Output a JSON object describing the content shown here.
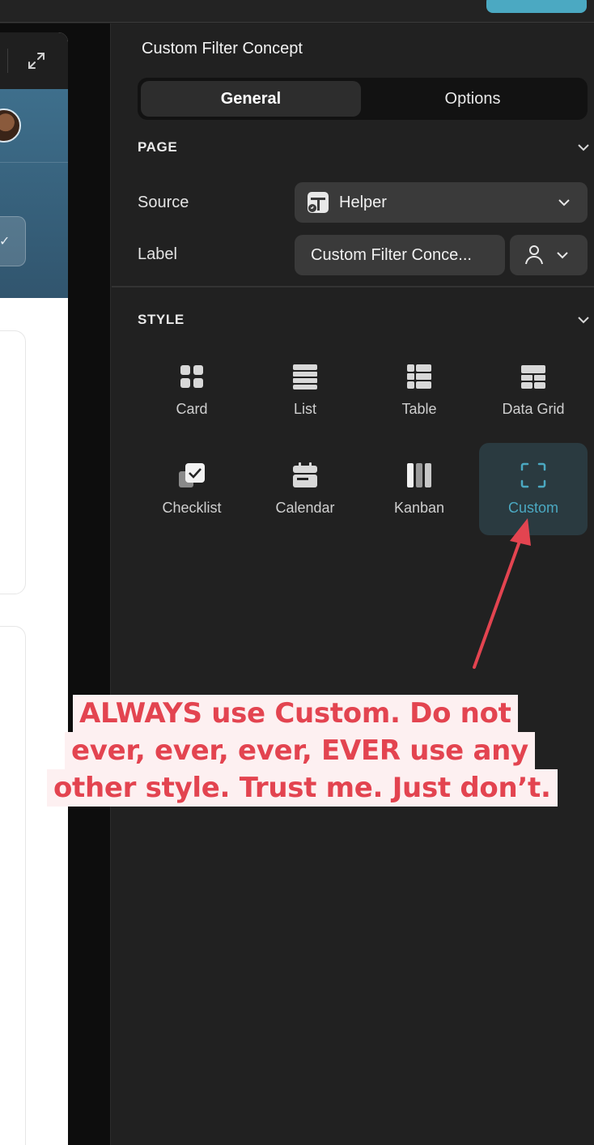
{
  "panel": {
    "title": "Custom Filter Concept",
    "tabs": [
      {
        "label": "General",
        "active": true
      },
      {
        "label": "Options",
        "active": false
      }
    ],
    "page_section": {
      "heading": "PAGE",
      "source": {
        "label": "Source",
        "value": "Helper",
        "icon": "helper-table-icon"
      },
      "label_row": {
        "label": "Label",
        "value": "Custom Filter Conce...",
        "icon": "person-icon"
      }
    },
    "style_section": {
      "heading": "STYLE",
      "items": [
        {
          "label": "Card",
          "icon": "card-grid-icon",
          "selected": false
        },
        {
          "label": "List",
          "icon": "list-icon",
          "selected": false
        },
        {
          "label": "Table",
          "icon": "table-icon",
          "selected": false
        },
        {
          "label": "Data Grid",
          "icon": "data-grid-icon",
          "selected": false
        },
        {
          "label": "Checklist",
          "icon": "checklist-icon",
          "selected": false
        },
        {
          "label": "Calendar",
          "icon": "calendar-icon",
          "selected": false
        },
        {
          "label": "Kanban",
          "icon": "kanban-icon",
          "selected": false
        },
        {
          "label": "Custom",
          "icon": "custom-frame-icon",
          "selected": true
        }
      ]
    }
  },
  "annotation": {
    "lines": [
      "ALWAYS use Custom. Do not",
      "ever, ever, ever, EVER use any",
      "other style. Trust me. Just don’t."
    ],
    "color": "#e34450"
  },
  "colors": {
    "accent": "#4ba9c2",
    "panel_bg": "#212121",
    "field_bg": "#3a3a3a"
  }
}
